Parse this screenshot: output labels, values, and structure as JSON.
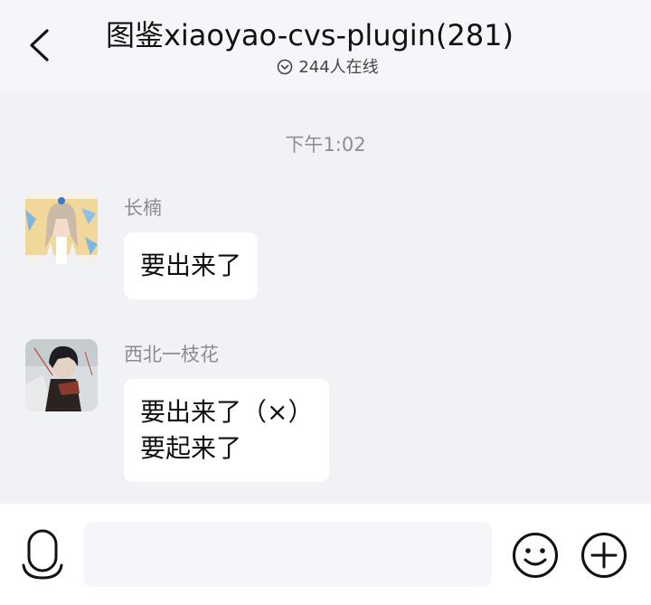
{
  "header": {
    "title": "图鉴xiaoyao-cvs-plugin(281)",
    "online_status": "244人在线",
    "back_icon": "chevron-left-icon",
    "online_icon": "chevron-down-circle-icon"
  },
  "time_divider": "下午1:02",
  "messages": [
    {
      "sender": "长楠",
      "text": "要出来了",
      "avatar": "anime-girl-avatar"
    },
    {
      "sender": "西北一枝花",
      "text": "要出来了（×）\n要起来了",
      "avatar": "dark-haired-character-avatar"
    }
  ],
  "composer": {
    "placeholder": "",
    "voice_icon": "microphone-icon",
    "emoji_icon": "smiley-icon",
    "more_icon": "plus-circle-icon"
  },
  "colors": {
    "background": "#f1f2f6",
    "bubble": "#ffffff",
    "header": "#f5f6fa"
  }
}
